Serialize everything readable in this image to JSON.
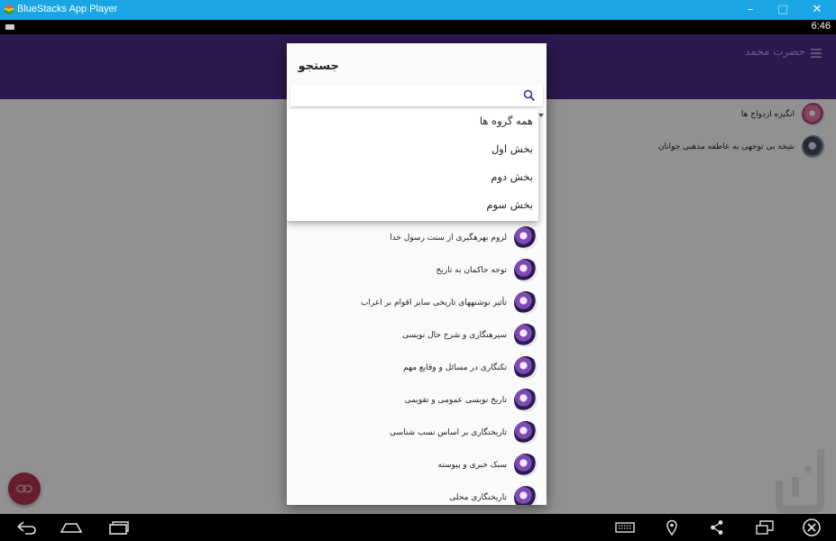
{
  "window": {
    "title": "BlueStacks App Player",
    "controls": {
      "minimize": "–",
      "maximize": "□",
      "close": "✕"
    }
  },
  "statusbar": {
    "time": "6:46"
  },
  "app": {
    "title": "حضرت محمد",
    "items": [
      {
        "text": "انگیزه ازدواج ها",
        "avatar": "pink"
      },
      {
        "text": "نتیجه بی توجهی به عاطفه مذهبی جوانان",
        "avatar": "grey"
      }
    ]
  },
  "dialog": {
    "title": "جستجو",
    "search": {
      "value": "",
      "placeholder": ""
    },
    "dropdown_options": [
      "همه گروه ها",
      "بخش اول",
      "بخش دوم",
      "بخش سوم"
    ],
    "items": [
      "لزوم بهرهگیری از سنت رسول خدا",
      "توجه حاکمان به تاریخ",
      "تأثیر نوشتههای تاریخی سایر اقوام بر اعراب",
      "سیرهنگاری و شرح حال نویسی",
      "تکنگاری در مسائل و وقایع مهم",
      "تاریخ نویسی عمومی و تقویمی",
      "تاریخنگاری بر اساس نسب شناسی",
      "سبک خبری و پیوسته",
      "تاریخنگاری محلی"
    ]
  },
  "colors": {
    "window_titlebar": "#1aa6e4",
    "toolbar": "#4a2a86",
    "fab": "#b0344f",
    "search_icon": "#4a2a86"
  },
  "icons": {
    "menu": "hamburger-icon",
    "search": "search-icon",
    "fab": "link-icon",
    "nav": [
      "back-icon",
      "home-icon",
      "recents-icon",
      "keyboard-icon",
      "location-icon",
      "share-icon",
      "multiscreen-icon",
      "close-icon"
    ]
  }
}
